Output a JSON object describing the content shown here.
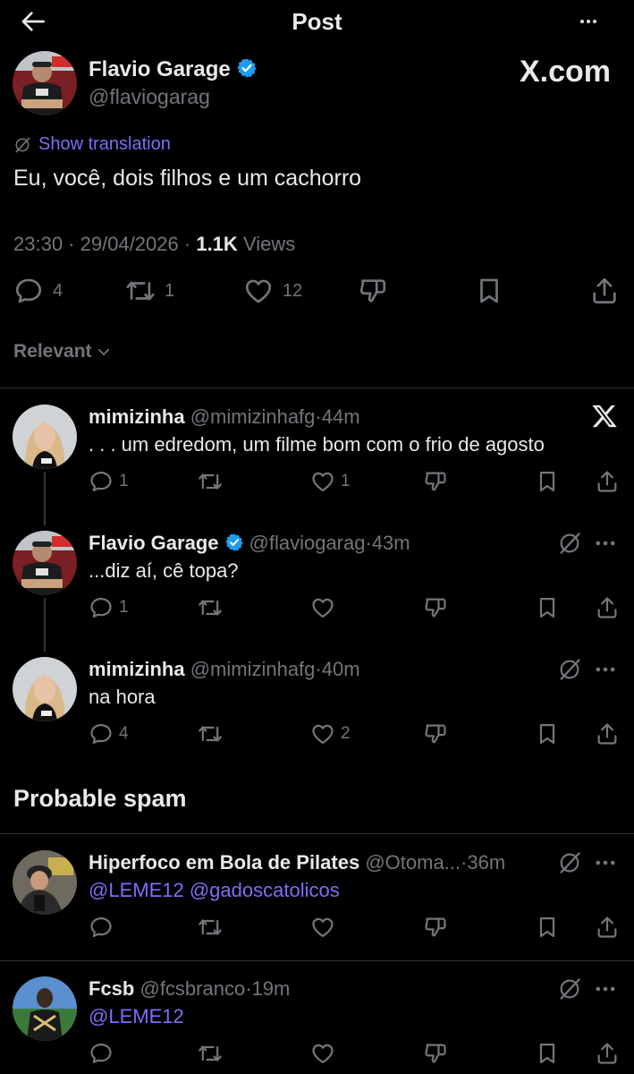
{
  "header": {
    "title": "Post"
  },
  "main_post": {
    "author_name": "Flavio Garage",
    "author_handle": "@flaviogarag",
    "watermark": "X.com",
    "show_translation": "Show translation",
    "text": "Eu, você, dois filhos e um cachorro",
    "time": "23:30",
    "date": "29/04/2026",
    "views_count": "1.1K",
    "views_label": "Views",
    "replies": "4",
    "reposts": "1",
    "likes": "12"
  },
  "sort": {
    "label": "Relevant"
  },
  "replies": [
    {
      "name": "mimizinha",
      "handle": "@mimizinhafg",
      "time": "44m",
      "text": ". . . um edredom, um filme bom com o frio de agosto",
      "replies": "1",
      "reposts": "",
      "likes": "1"
    },
    {
      "name": "Flavio Garage",
      "handle": "@flaviogarag",
      "time": "43m",
      "text": "...diz aí, cê topa?",
      "replies": "1",
      "reposts": "",
      "likes": ""
    },
    {
      "name": "mimizinha",
      "handle": "@mimizinhafg",
      "time": "40m",
      "text": "na hora",
      "replies": "4",
      "reposts": "",
      "likes": "2"
    }
  ],
  "spam_section": {
    "title": "Probable spam"
  },
  "spam_replies": [
    {
      "name": "Hiperfoco em Bola de Pilates",
      "handle": "@Otoma...",
      "time": "36m",
      "mention1": "@LEME12",
      "mention2": "@gadoscatolicos"
    },
    {
      "name": "Fcsb",
      "handle": "@fcsbranco",
      "time": "19m",
      "mention1": "@LEME12"
    }
  ],
  "separator": "·",
  "colors": {
    "background": "#000000",
    "text": "#e7e9ea",
    "muted": "#71767b",
    "accent": "#7d6df8",
    "verified": "#1d9bf0",
    "divider": "#2f3336"
  }
}
